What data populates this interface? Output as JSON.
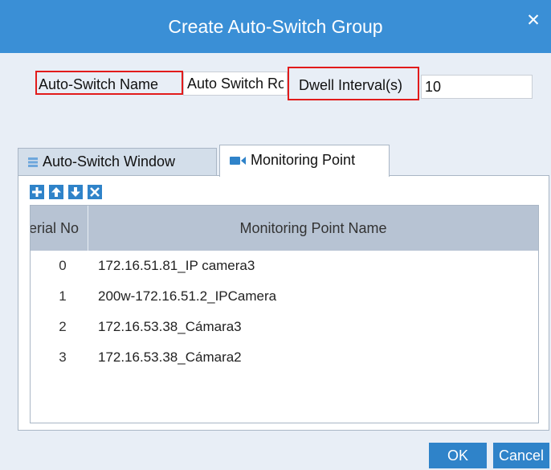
{
  "dialog": {
    "title": "Create Auto-Switch Group"
  },
  "form": {
    "name_label": "Auto-Switch Name",
    "name_value": "Auto Switch Round Robin",
    "interval_label": "Dwell Interval(s)",
    "interval_value": "10"
  },
  "tabs": [
    {
      "label": "Auto-Switch Window",
      "icon": "grid-list-icon",
      "active": false
    },
    {
      "label": "Monitoring Point",
      "icon": "video-camera-icon",
      "active": true
    }
  ],
  "toolbar": {
    "icons": [
      "plus-icon",
      "arrow-up-icon",
      "arrow-down-icon",
      "delete-x-icon"
    ],
    "color": "#2f83c9"
  },
  "table": {
    "columns": [
      "Serial No",
      "Monitoring Point Name"
    ],
    "rows": [
      {
        "serial": "0",
        "name": "172.16.51.81_IP camera3"
      },
      {
        "serial": "1",
        "name": "200w-172.16.51.2_IPCamera"
      },
      {
        "serial": "2",
        "name": "172.16.53.38_Cámara3"
      },
      {
        "serial": "3",
        "name": "172.16.53.38_Cámara2"
      }
    ]
  },
  "buttons": {
    "ok": "OK",
    "cancel": "Cancel"
  },
  "colors": {
    "title_bar": "#3a8fd6",
    "highlight_box": "#e21b1b",
    "background": "#e8eef6",
    "table_header": "#b7c3d3"
  }
}
